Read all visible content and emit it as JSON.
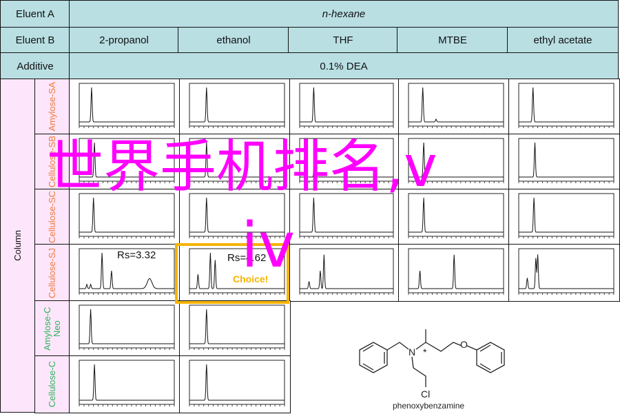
{
  "header": {
    "eluent_a_label": "Eluent A",
    "eluent_a_value": "n-hexane",
    "eluent_b_label": "Eluent B",
    "eluent_b_values": [
      "2-propanol",
      "ethanol",
      "THF",
      "MTBE",
      "ethyl acetate"
    ],
    "additive_label": "Additive",
    "additive_value": "0.1% DEA"
  },
  "column_label": "Column",
  "rows": [
    {
      "label": "Amylose-SA",
      "color": "#ee7a3a"
    },
    {
      "label": "Cellulose-SB",
      "color": "#ee7a3a"
    },
    {
      "label": "Cellulose-SC",
      "color": "#ee7a3a"
    },
    {
      "label": "Cellulose-SJ",
      "color": "#ee7a3a"
    },
    {
      "label": "Amylose-C Neo",
      "color": "#2db35a"
    },
    {
      "label": "Cellulose-C",
      "color": "#2db35a"
    }
  ],
  "chromatograms": [
    [
      [
        [
          1.3,
          1
        ]
      ],
      [
        [
          1.8,
          1
        ]
      ],
      [
        [
          1.5,
          1
        ]
      ],
      [
        [
          1.5,
          1
        ],
        [
          2.9,
          0.08
        ]
      ],
      [
        [
          1.5,
          1
        ]
      ]
    ],
    [
      [
        [
          1.6,
          1
        ]
      ],
      [
        [
          1.8,
          1
        ]
      ],
      [
        [
          1.6,
          1
        ]
      ],
      [
        [
          1.6,
          1
        ]
      ],
      [
        [
          1.7,
          1
        ]
      ]
    ],
    [
      [
        [
          1.5,
          1
        ]
      ],
      [
        [
          1.8,
          1
        ]
      ],
      [
        [
          1.5,
          1
        ]
      ],
      [
        [
          1.6,
          1
        ]
      ],
      [
        [
          1.6,
          1
        ]
      ]
    ],
    [
      [
        [
          0.8,
          0.12
        ],
        [
          1.2,
          0.12
        ],
        [
          2.4,
          1
        ],
        [
          3.4,
          0.5
        ],
        [
          7.4,
          0.28
        ]
      ],
      [
        [
          0.9,
          0.4
        ],
        [
          2.2,
          1
        ],
        [
          2.7,
          0.8
        ]
      ],
      [
        [
          1.0,
          0.2
        ],
        [
          2.2,
          0.5
        ],
        [
          2.6,
          0.95
        ]
      ],
      [
        [
          1.2,
          0.5
        ],
        [
          4.8,
          0.95
        ]
      ],
      [
        [
          0.9,
          0.3
        ],
        [
          1.8,
          0.85
        ],
        [
          2.0,
          0.95
        ]
      ]
    ],
    [
      [
        [
          1.2,
          1
        ]
      ],
      [
        [
          1.8,
          1
        ]
      ]
    ],
    [
      [
        [
          1.6,
          1
        ]
      ],
      [
        [
          1.8,
          1
        ]
      ]
    ]
  ],
  "annotations": {
    "rs_1": "Rs=3.32",
    "rs_2": "Rs=4.62",
    "choice": "Choice!",
    "highlight_color": "#f5b400"
  },
  "molecule": {
    "name": "phenoxybenzamine",
    "atoms": [
      "N",
      "O",
      "Cl",
      "*"
    ]
  },
  "overlay": {
    "line1": "世界手机排名,v",
    "line2": "iv",
    "color": "#ff00ff"
  }
}
